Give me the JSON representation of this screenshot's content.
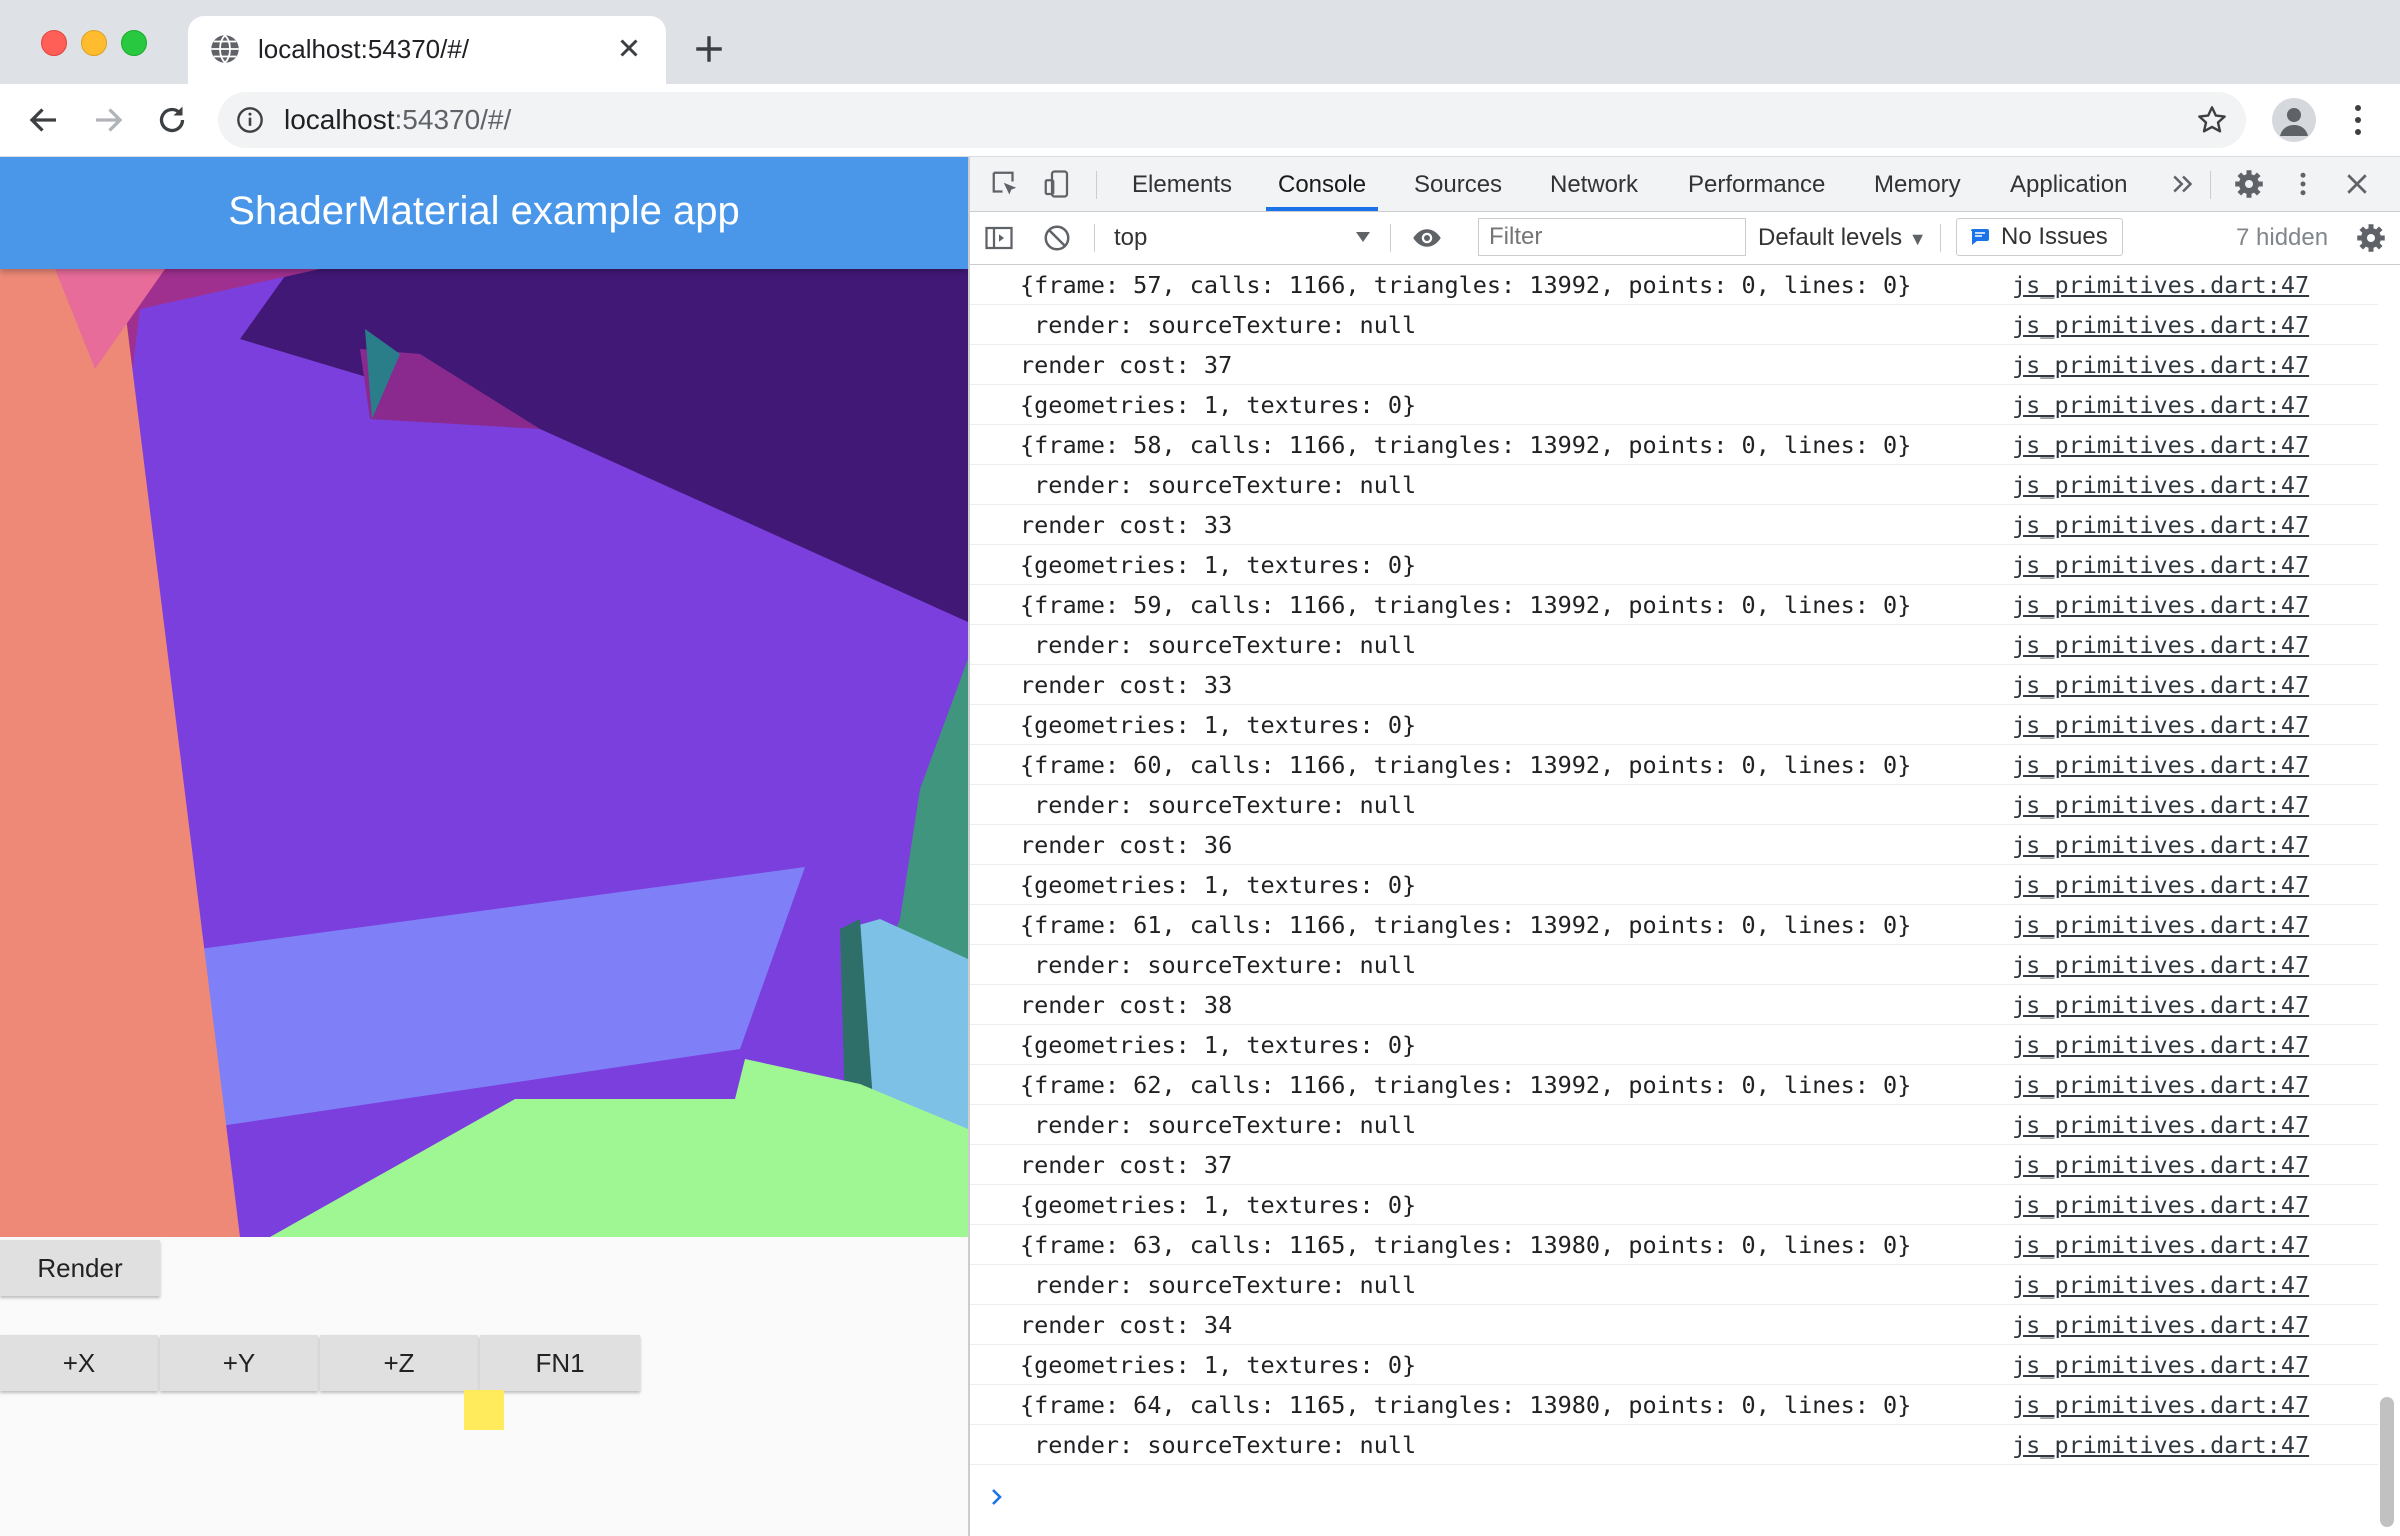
{
  "tab": {
    "title": "localhost:54370/#/"
  },
  "address": {
    "host": "localhost",
    "rest": ":54370/#/"
  },
  "app": {
    "title": "ShaderMaterial example app",
    "render_button": "Render",
    "axis_buttons": [
      "+X",
      "+Y",
      "+Z",
      "FN1"
    ]
  },
  "devtools": {
    "tabs": [
      "Elements",
      "Console",
      "Sources",
      "Network",
      "Performance",
      "Memory",
      "Application"
    ],
    "active_tab": "Console",
    "context": "top",
    "filter_placeholder": "Filter",
    "levels": "Default levels",
    "issues": "No Issues",
    "hidden": "7 hidden"
  },
  "console": {
    "source": "js_primitives.dart:47",
    "rows": [
      "{frame: 57, calls: 1166, triangles: 13992, points: 0, lines: 0}",
      " render: sourceTexture: null",
      "render cost: 37",
      "{geometries: 1, textures: 0}",
      "{frame: 58, calls: 1166, triangles: 13992, points: 0, lines: 0}",
      " render: sourceTexture: null",
      "render cost: 33",
      "{geometries: 1, textures: 0}",
      "{frame: 59, calls: 1166, triangles: 13992, points: 0, lines: 0}",
      " render: sourceTexture: null",
      "render cost: 33",
      "{geometries: 1, textures: 0}",
      "{frame: 60, calls: 1166, triangles: 13992, points: 0, lines: 0}",
      " render: sourceTexture: null",
      "render cost: 36",
      "{geometries: 1, textures: 0}",
      "{frame: 61, calls: 1166, triangles: 13992, points: 0, lines: 0}",
      " render: sourceTexture: null",
      "render cost: 38",
      "{geometries: 1, textures: 0}",
      "{frame: 62, calls: 1166, triangles: 13992, points: 0, lines: 0}",
      " render: sourceTexture: null",
      "render cost: 37",
      "{geometries: 1, textures: 0}",
      "{frame: 63, calls: 1165, triangles: 13980, points: 0, lines: 0}",
      " render: sourceTexture: null",
      "render cost: 34",
      "{geometries: 1, textures: 0}",
      "{frame: 64, calls: 1165, triangles: 13980, points: 0, lines: 0}",
      " render: sourceTexture: null"
    ]
  },
  "colors": {
    "appbar": "#4a97ea",
    "accent": "#1a73e8",
    "swatch": "#ffeb5b"
  }
}
